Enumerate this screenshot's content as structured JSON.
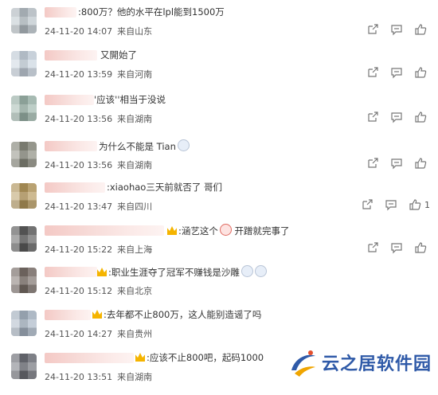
{
  "comments": [
    {
      "text": ":800万？他的水平在lpl能到1500万",
      "time": "24-11-20 14:07",
      "location": "来自山东",
      "likes": ""
    },
    {
      "text": "又開始了",
      "time": "24-11-20 13:59",
      "location": "来自河南",
      "likes": ""
    },
    {
      "text": "'应该''相当于没说",
      "time": "24-11-20 13:56",
      "location": "来自湖南",
      "likes": ""
    },
    {
      "text": "为什么不能是 Tian",
      "time": "24-11-20 13:56",
      "location": "来自湖南",
      "likes": ""
    },
    {
      "text": ":xiaohao三天前就否了 哥们",
      "time": "24-11-20 13:47",
      "location": "来自四川",
      "likes": "1"
    },
    {
      "text": ":涵艺这个",
      "text2": "开蹭就完事了",
      "time": "24-11-20 15:22",
      "location": "来自上海",
      "likes": ""
    },
    {
      "text": ":职业生涯夺了冠军不赚钱是沙雕",
      "time": "24-11-20 15:12",
      "location": "来自北京",
      "likes": ""
    },
    {
      "text": ":去年都不止800万，这人能别造谣了吗",
      "time": "24-11-20 14:27",
      "location": "来自贵州",
      "likes": ""
    },
    {
      "text": ":应该不止800吧，起码1000",
      "time": "24-11-20 13:51",
      "location": "来自湖南",
      "likes": ""
    }
  ],
  "icons": {
    "share": "share-icon",
    "comment": "comment-icon",
    "like": "like-icon"
  },
  "watermark": {
    "text": "云之居软件园"
  },
  "colors": {
    "accent": "#2f5aa8",
    "text": "#333333",
    "meta": "#555555"
  }
}
